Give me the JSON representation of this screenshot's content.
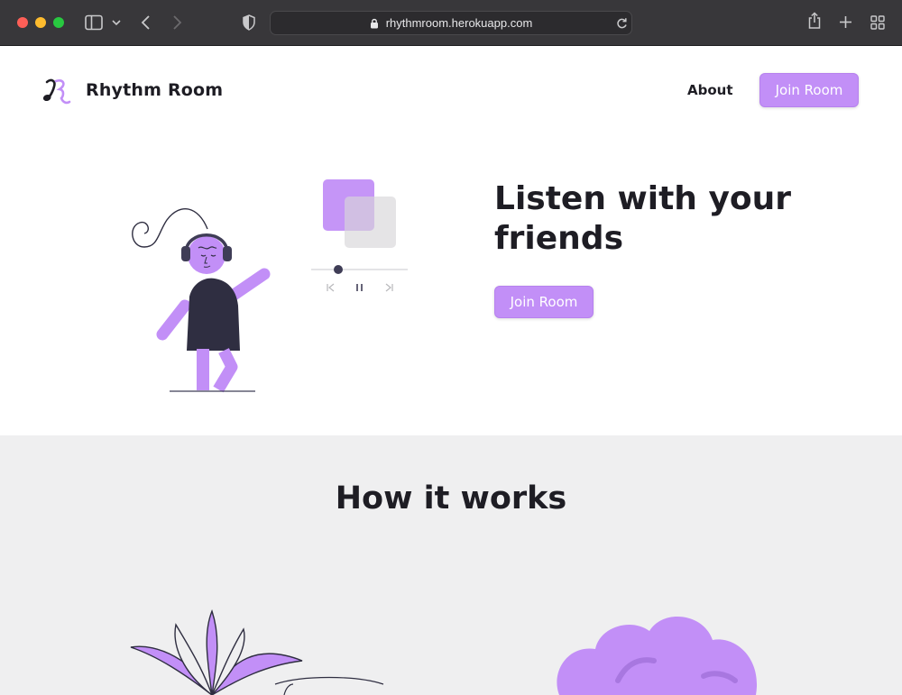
{
  "browser": {
    "url": "rhythmroom.herokuapp.com"
  },
  "header": {
    "brand_name": "Rhythm Room",
    "nav_about": "About",
    "nav_join": "Join Room"
  },
  "hero": {
    "title": "Listen with your friends",
    "cta": "Join Room"
  },
  "how_it_works": {
    "title": "How it works"
  },
  "colors": {
    "accent": "#c28ff7",
    "dark": "#2f2e41",
    "section_bg": "#efeff0"
  }
}
